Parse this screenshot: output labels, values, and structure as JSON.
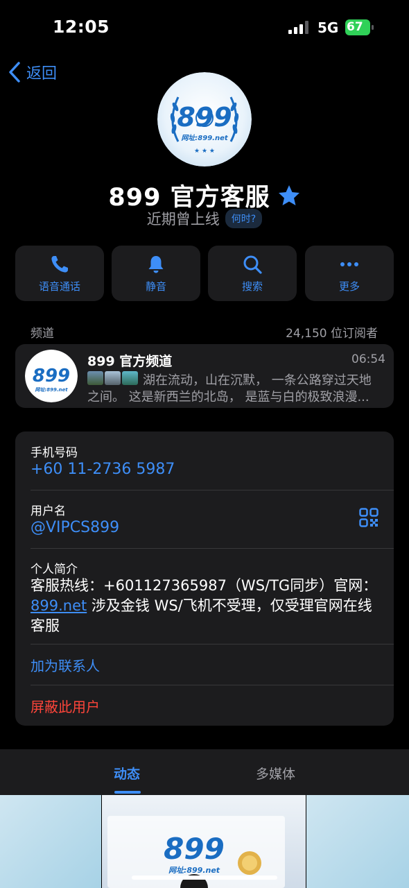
{
  "status_bar": {
    "time": "12:05",
    "network": "5G",
    "battery": "67"
  },
  "nav": {
    "back_label": "返回"
  },
  "profile": {
    "name": "899 官方客服",
    "last_seen": "近期曾上线",
    "when_button": "何时?",
    "logo_text": "899",
    "logo_url_text": "网址:899.net"
  },
  "actions": [
    {
      "label": "语音通话",
      "icon": "phone-icon"
    },
    {
      "label": "静音",
      "icon": "bell-icon"
    },
    {
      "label": "搜索",
      "icon": "search-icon"
    },
    {
      "label": "更多",
      "icon": "more-icon"
    }
  ],
  "channel": {
    "section_label": "频道",
    "subscribers": "24,150 位订阅者",
    "title": "899 官方频道",
    "time": "06:54",
    "preview_line1": "湖在流动，山在沉默， 一条公路穿过天地",
    "preview_line2": "之间。 这是新西兰的北岛， 是蓝与白的极致浪漫..."
  },
  "info": {
    "phone_label": "手机号码",
    "phone_value": "+60 11-2736 5987",
    "username_label": "用户名",
    "username_value": "@VIPCS899",
    "bio_label": "个人简介",
    "bio_part1": "客服热线：+601127365987（WS/TG同步）官网：",
    "bio_link": "899.net",
    "bio_part2": " 涉及金钱 WS/飞机不受理，仅受理官网在线客服",
    "add_contact": "加为联系人",
    "block_user": "屏蔽此用户"
  },
  "tabs": {
    "posts": "动态",
    "media": "多媒体"
  },
  "colors": {
    "accent": "#3e8ef7",
    "danger": "#ff453a",
    "card": "#1c1c1e",
    "battery": "#30d158"
  }
}
